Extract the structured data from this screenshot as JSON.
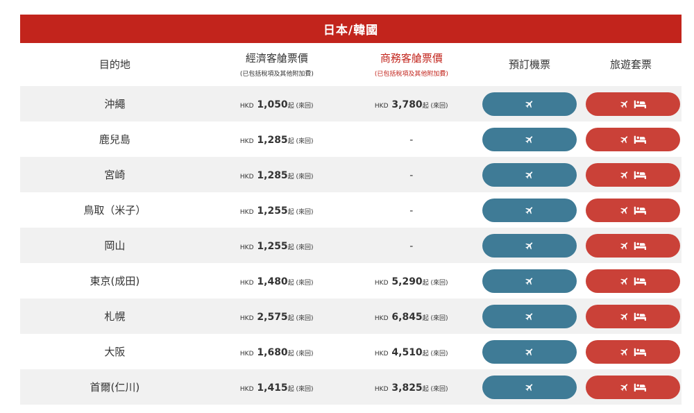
{
  "section_title": "日本/韓國",
  "headers": {
    "destination": "目的地",
    "economy": "經濟客艙票價",
    "economy_note": "(已包括稅項及其他附加費)",
    "business": "商務客艙票價",
    "business_note": "(已包括稅項及其他附加費)",
    "book": "預訂機票",
    "package": "旅遊套票"
  },
  "colors": {
    "title_bar": "#c2241c",
    "book_button": "#3f7b96",
    "package_button": "#ca4138",
    "business_header": "#c2241c",
    "row_shade": "#f1f1f1"
  },
  "icons": {
    "book": "plane-icon",
    "package": [
      "plane-icon",
      "bed-icon"
    ]
  },
  "rows": [
    {
      "destination": "沖繩",
      "eco_currency": "HKD",
      "eco_amount": "1,050",
      "eco_suffix": "起 (來回)",
      "bus_currency": "HKD",
      "bus_amount": "3,780",
      "bus_suffix": "起 (來回)",
      "bus_none": ""
    },
    {
      "destination": "鹿兒島",
      "eco_currency": "HKD",
      "eco_amount": "1,285",
      "eco_suffix": "起 (來回)",
      "bus_currency": "",
      "bus_amount": "",
      "bus_suffix": "",
      "bus_none": "-"
    },
    {
      "destination": "宮崎",
      "eco_currency": "HKD",
      "eco_amount": "1,285",
      "eco_suffix": "起 (來回)",
      "bus_currency": "",
      "bus_amount": "",
      "bus_suffix": "",
      "bus_none": "-"
    },
    {
      "destination": "鳥取（米子）",
      "eco_currency": "HKD",
      "eco_amount": "1,255",
      "eco_suffix": "起 (來回)",
      "bus_currency": "",
      "bus_amount": "",
      "bus_suffix": "",
      "bus_none": "-"
    },
    {
      "destination": "岡山",
      "eco_currency": "HKD",
      "eco_amount": "1,255",
      "eco_suffix": "起 (來回)",
      "bus_currency": "",
      "bus_amount": "",
      "bus_suffix": "",
      "bus_none": "-"
    },
    {
      "destination": "東京(成田)",
      "eco_currency": "HKD",
      "eco_amount": "1,480",
      "eco_suffix": "起 (來回)",
      "bus_currency": "HKD",
      "bus_amount": "5,290",
      "bus_suffix": "起 (來回)",
      "bus_none": ""
    },
    {
      "destination": "札幌",
      "eco_currency": "HKD",
      "eco_amount": "2,575",
      "eco_suffix": "起 (來回)",
      "bus_currency": "HKD",
      "bus_amount": "6,845",
      "bus_suffix": "起 (來回)",
      "bus_none": ""
    },
    {
      "destination": "大阪",
      "eco_currency": "HKD",
      "eco_amount": "1,680",
      "eco_suffix": "起 (來回)",
      "bus_currency": "HKD",
      "bus_amount": "4,510",
      "bus_suffix": "起 (來回)",
      "bus_none": ""
    },
    {
      "destination": "首爾(仁川)",
      "eco_currency": "HKD",
      "eco_amount": "1,415",
      "eco_suffix": "起 (來回)",
      "bus_currency": "HKD",
      "bus_amount": "3,825",
      "bus_suffix": "起 (來回)",
      "bus_none": ""
    }
  ]
}
